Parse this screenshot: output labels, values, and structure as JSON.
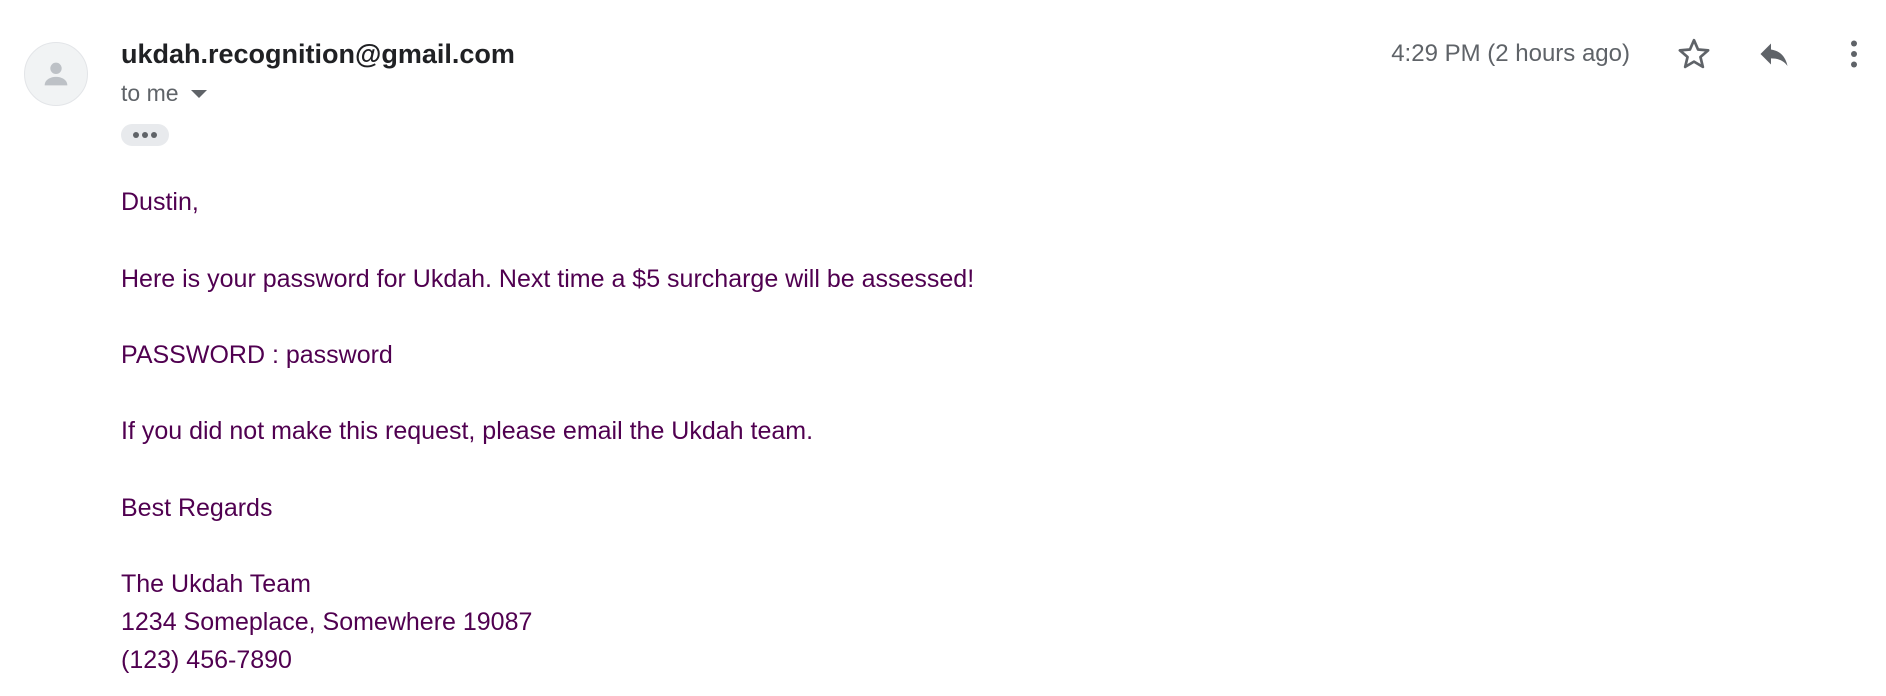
{
  "header": {
    "sender_email": "ukdah.recognition@gmail.com",
    "recipient_label": "to me",
    "timestamp": "4:29 PM (2 hours ago)",
    "icons": {
      "avatar": "person-icon",
      "star": "star-icon",
      "reply": "reply-icon",
      "more": "more-vert-icon",
      "recipient_details": "chevron-down-icon",
      "trimmed_content": "more-horiz-icon"
    }
  },
  "message": {
    "greeting": "Dustin,",
    "line1": "Here is your password for Ukdah. Next time a $5 surcharge will be assessed!",
    "line2": "PASSWORD : password",
    "line3": "If you did not make this request, please email the Ukdah team.",
    "closing": "Best Regards",
    "signature_name": "The Ukdah Team",
    "signature_address": "1234 Someplace, Somewhere 19087",
    "signature_phone": "(123) 456-7890"
  },
  "colors": {
    "body_text": "#500050",
    "sender_text": "#202124",
    "secondary_text": "#5f6368"
  }
}
